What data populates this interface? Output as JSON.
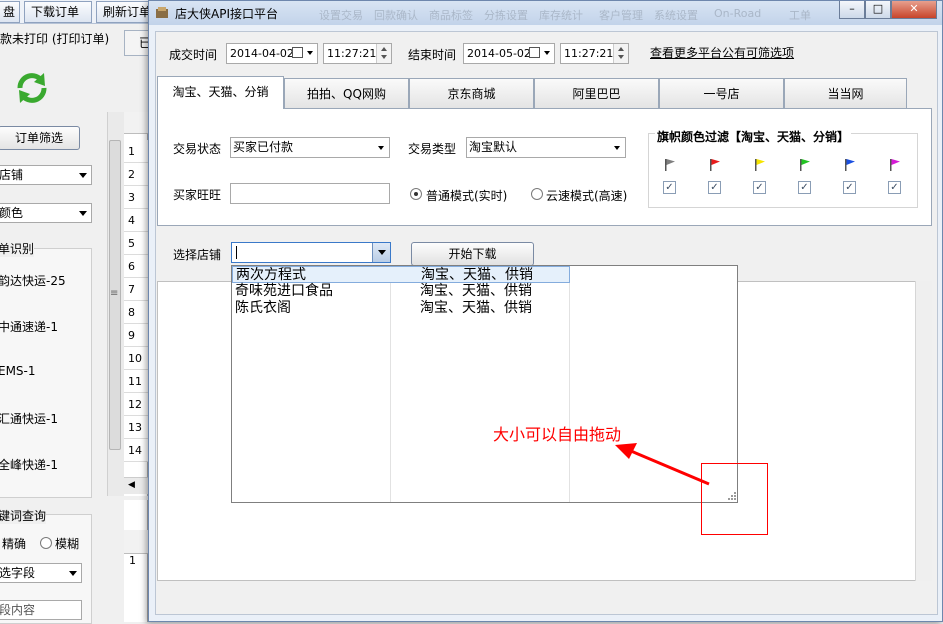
{
  "bg_app": {
    "toolbar": [
      "盘",
      "下载订单",
      "刷新订单"
    ],
    "section_title": "款未打印 (打印订单)",
    "filter_button": "订单筛选",
    "combo_store": "店铺",
    "combo_color": "颜色",
    "group_title": "单识别",
    "express_items": [
      "韵达快运-25",
      "中通速递-1",
      "EMS-1",
      "汇通快运-1",
      "全峰快递-1"
    ],
    "keyword_title": "键词查询",
    "radio_exact": "精确",
    "radio_fuzzy": "模糊",
    "field_select": "选字段",
    "field_content": "段内容",
    "row_numbers": [
      "1",
      "2",
      "3",
      "4",
      "5",
      "6",
      "7",
      "8",
      "9",
      "10",
      "11",
      "12",
      "13",
      "14"
    ],
    "row_number_lower": "1",
    "right_tab_partial": "已"
  },
  "dialog": {
    "title": "店大侠API接口平台",
    "ghost_titles": [
      "设置交易",
      "回款确认",
      "商品标签",
      "分拣设置",
      "库存统计",
      "客户管理",
      "系统设置",
      "On-Road",
      "工单"
    ],
    "win_min": "–",
    "win_max": "□",
    "win_close": "✕",
    "trade_time_label": "成交时间",
    "start_date": "2014-04-02",
    "start_time": "11:27:21",
    "end_time_label": "结束时间",
    "end_date": "2014-05-02",
    "end_time": "11:27:21",
    "more_link": "查看更多平台公有可筛选项",
    "tabs": [
      "淘宝、天猫、分销",
      "拍拍、QQ网购",
      "京东商城",
      "阿里巴巴",
      "一号店",
      "当当网"
    ],
    "trade_status_label": "交易状态",
    "trade_status_value": "买家已付款",
    "trade_type_label": "交易类型",
    "trade_type_value": "淘宝默认",
    "buyer_label": "买家旺旺",
    "buyer_value": "",
    "mode_normal": "普通模式(实时)",
    "mode_cloud": "云速模式(高速)",
    "flag_filter_title": "旗帜颜色过滤【淘宝、天猫、分销】",
    "flags": [
      {
        "color": "#7f7f7f",
        "checked": true
      },
      {
        "color": "#e81c1c",
        "checked": true
      },
      {
        "color": "#f5e400",
        "checked": true
      },
      {
        "color": "#22c322",
        "checked": true
      },
      {
        "color": "#1a4fe0",
        "checked": true
      },
      {
        "color": "#d61ad6",
        "checked": true
      }
    ],
    "check_mark": "✓",
    "select_store_label": "选择店铺",
    "store_input_value": "",
    "start_download_button": "开始下载",
    "store_list": [
      {
        "name": "两次方程式",
        "platform": "淘宝、天猫、供销"
      },
      {
        "name": "奇味苑进口食品",
        "platform": "淘宝、天猫、供销"
      },
      {
        "name": "陈氏衣阁",
        "platform": "淘宝、天猫、供销"
      }
    ],
    "annotation": "大小可以自由拖动"
  }
}
